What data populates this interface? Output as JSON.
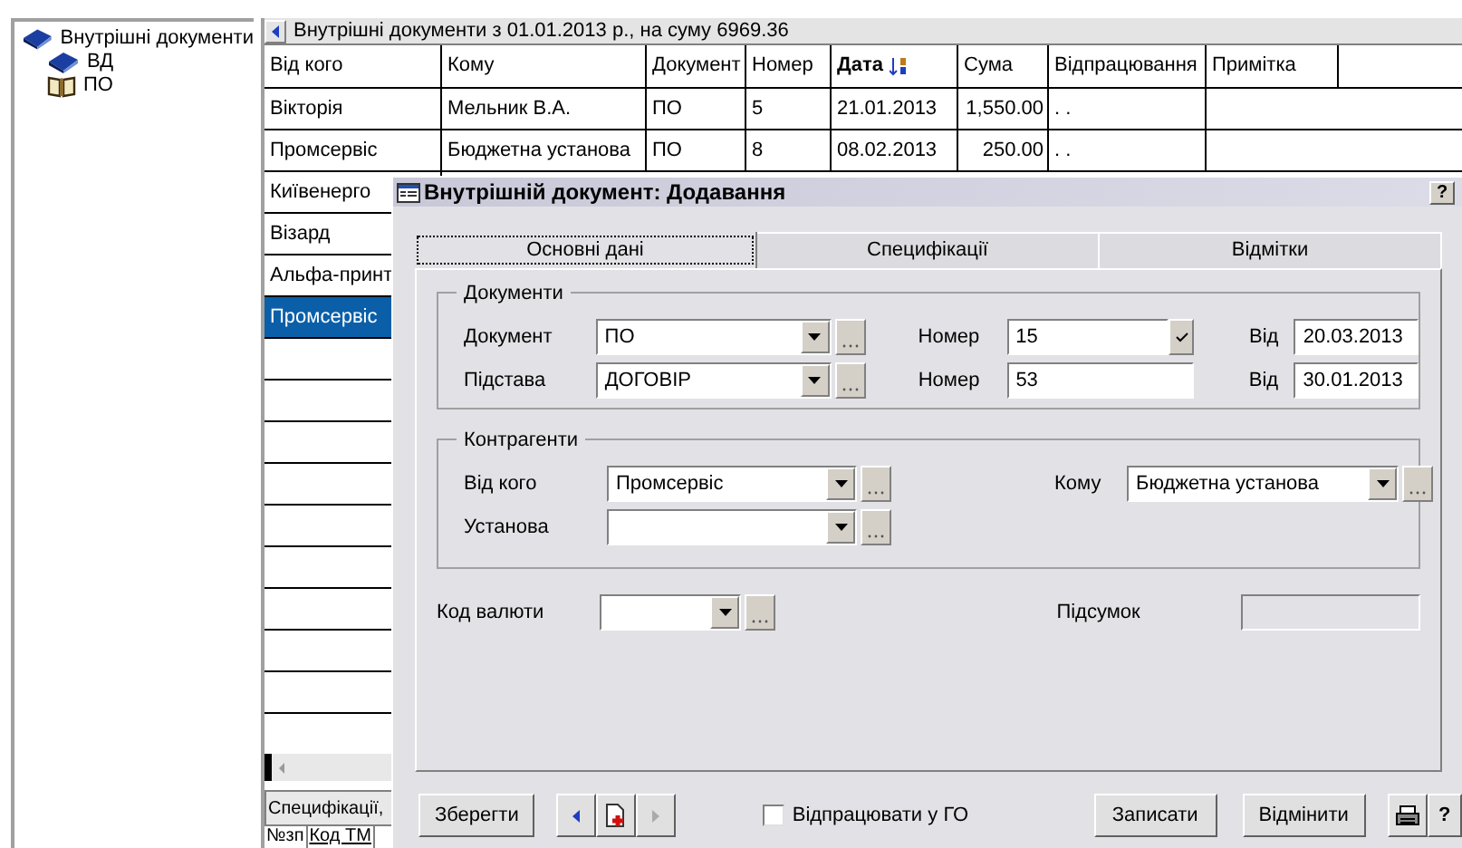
{
  "tree": {
    "items": [
      {
        "label": "Внутрішні документи",
        "kind": "closed-book",
        "children": [
          {
            "label": "ВД",
            "kind": "closed-book"
          },
          {
            "label": "ПО",
            "kind": "open-book"
          }
        ]
      }
    ]
  },
  "grid": {
    "caption": "Внутрішні документи з 01.01.2013 р., на суму 6969.36",
    "columns": [
      {
        "label": "Від кого",
        "sorted": false
      },
      {
        "label": "Кому",
        "sorted": false
      },
      {
        "label": "Документ",
        "sorted": false
      },
      {
        "label": "Номер",
        "sorted": false
      },
      {
        "label": "Дата",
        "sorted": true
      },
      {
        "label": "Сума",
        "sorted": false
      },
      {
        "label": "Відпрацювання",
        "sorted": false
      },
      {
        "label": "Примітка",
        "sorted": false
      }
    ],
    "rows": [
      {
        "cells": [
          "Вікторія",
          "Мельник В.А.",
          "ПО",
          "5",
          "21.01.2013",
          "1,550.00",
          ". ."
        ],
        "selected": false
      },
      {
        "cells": [
          "Промсервіс",
          "Бюджетна  установа",
          "ПО",
          "8",
          "08.02.2013",
          "250.00",
          ". ."
        ],
        "selected": false
      },
      {
        "cells": [
          "Київенерго"
        ],
        "selected": false
      },
      {
        "cells": [
          "Візард"
        ],
        "selected": false
      },
      {
        "cells": [
          "Альфа-принт"
        ],
        "selected": false
      },
      {
        "cells": [
          "Промсервіс"
        ],
        "selected": true
      }
    ],
    "detail_tab": "Специфікації,",
    "detail_columns": [
      "№зп",
      "Код ТМ"
    ]
  },
  "dialog": {
    "title": "Внутрішній документ: Додавання",
    "help": "?",
    "tabs": [
      {
        "label": "Основні дані",
        "selected": true
      },
      {
        "label": "Специфікації",
        "selected": false
      },
      {
        "label": "Відмітки",
        "selected": false
      }
    ],
    "documents": {
      "title": "Документи",
      "rows": [
        {
          "label": "Документ",
          "value": "ПО",
          "number_label": "Номер",
          "number": "15",
          "check": true,
          "date_label": "Від",
          "date": "20.03.2013"
        },
        {
          "label": "Підстава",
          "value": "ДОГОВІР",
          "number_label": "Номер",
          "number": "53",
          "check": false,
          "date_label": "Від",
          "date": "30.01.2013"
        }
      ]
    },
    "counterparties": {
      "title": "Контрагенти",
      "from": {
        "label": "Від кого",
        "value": "Промсервіс"
      },
      "institution": {
        "label": "Установа"
      },
      "to": {
        "label": "Кому",
        "value": "Бюджетна  установа"
      }
    },
    "currency": {
      "label": "Код валюти"
    },
    "total": {
      "label": "Підсумок"
    },
    "save": "Зберегти",
    "work_off": {
      "label": "Відпрацювати у ГО",
      "checked": false
    },
    "buttons": [
      "Записати",
      "Відмінити"
    ],
    "help_button": "?"
  }
}
